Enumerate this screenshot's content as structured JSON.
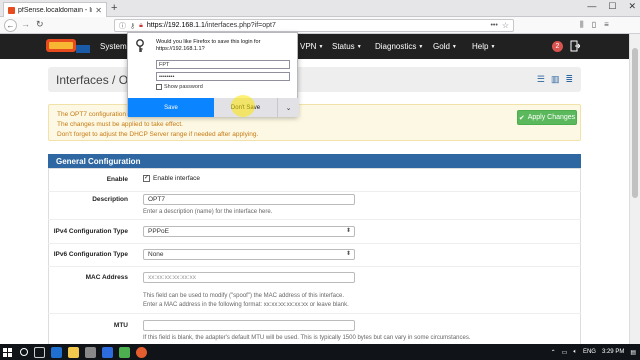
{
  "browser": {
    "tab_title": "pfSense.localdomain - Interfac",
    "url_host": "https://192.168.1.1",
    "url_path": "/interfaces.php?if=opt7",
    "new_tab": "+",
    "win_min": "—",
    "win_max": "☐",
    "win_close": "✕",
    "tab_close": "✕",
    "url_more": "•••"
  },
  "pfsense": {
    "menu": [
      "System",
      "VPN",
      "Status",
      "Diagnostics",
      "Gold",
      "Help"
    ],
    "notification_count": "2"
  },
  "page": {
    "breadcrumb": "Interfaces / OPT",
    "alert_lines": [
      "The OPT7 configuration",
      "The changes must be applied to take effect.",
      "Don't forget to adjust the DHCP Server range if needed after applying."
    ],
    "apply_button": "Apply Changes",
    "panel_title": "General Configuration",
    "enable_label": "Enable",
    "enable_text": "Enable interface",
    "enable_checked": "✓",
    "description_label": "Description",
    "description_value": "OPT7",
    "description_help": "Enter a description (name) for the interface here.",
    "ipv4_label": "IPv4 Configuration Type",
    "ipv4_value": "PPPoE",
    "ipv6_label": "IPv6 Configuration Type",
    "ipv6_value": "None",
    "mac_label": "MAC Address",
    "mac_placeholder": "xx:xx:xx:xx:xx:xx",
    "mac_help1": "This field can be used to modify (\"spoof\") the MAC address of this interface.",
    "mac_help2": "Enter a MAC address in the following format: xx:xx:xx:xx:xx:xx or leave blank.",
    "mtu_label": "MTU",
    "mtu_help": "If this field is blank, the adapter's default MTU will be used. This is typically 1500 bytes but can vary in some circumstances."
  },
  "popup": {
    "message": "Would you like Firefox to save this login for https://192.168.1.1?",
    "username": "FPT",
    "password": "••••••••",
    "show_password": "Show password",
    "save": "Save",
    "dont_save": "Don't Save",
    "dropdown": "⌄"
  },
  "taskbar": {
    "lang": "ENG",
    "time": "3:29 PM"
  },
  "colors": {
    "pf_header": "#212121",
    "pf_blue": "#2e67a1",
    "apply_green": "#5cb85c",
    "alert_text": "#c67a13",
    "firefox_blue": "#0a84ff"
  }
}
